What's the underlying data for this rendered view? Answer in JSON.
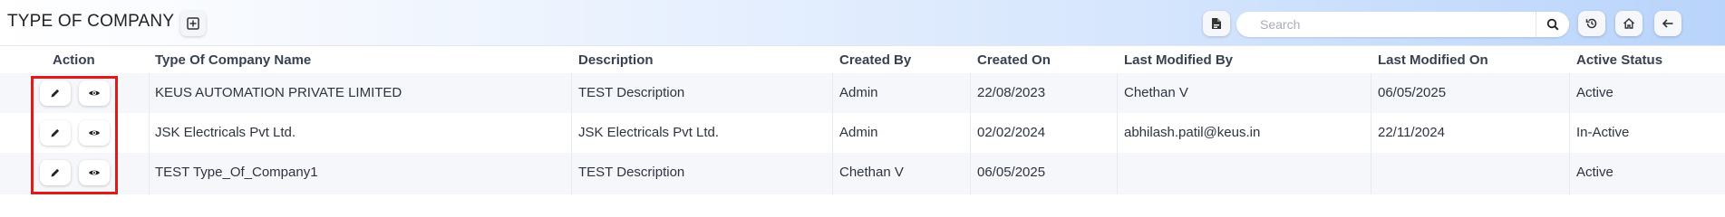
{
  "header": {
    "title": "TYPE OF COMPANY",
    "search_placeholder": "Search",
    "search_value": ""
  },
  "icons": {
    "grid": "grid-plus-icon",
    "report": "document-icon",
    "search": "search-icon",
    "history": "history-icon",
    "home": "home-icon",
    "back": "arrow-left-icon",
    "edit": "pencil-icon",
    "view": "eye-icon"
  },
  "table": {
    "columns": [
      "Action",
      "Type Of Company Name",
      "Description",
      "Created By",
      "Created On",
      "Last Modified By",
      "Last Modified On",
      "Active Status"
    ],
    "rows": [
      {
        "name": "KEUS AUTOMATION PRIVATE LIMITED",
        "description": "TEST Description",
        "created_by": "Admin",
        "created_on": "22/08/2023",
        "modified_by": "Chethan V",
        "modified_on": "06/05/2025",
        "status": "Active"
      },
      {
        "name": "JSK Electricals Pvt Ltd.",
        "description": "JSK Electricals Pvt Ltd.",
        "created_by": "Admin",
        "created_on": "02/02/2024",
        "modified_by": "abhilash.patil@keus.in",
        "modified_on": "22/11/2024",
        "status": "In-Active"
      },
      {
        "name": "TEST Type_Of_Company1",
        "description": "TEST Description",
        "created_by": "Chethan V",
        "created_on": "06/05/2025",
        "modified_by": "",
        "modified_on": "",
        "status": "Active"
      }
    ]
  },
  "colors": {
    "highlight": "#e01919",
    "header_gradient_end": "#b9d4fb"
  }
}
